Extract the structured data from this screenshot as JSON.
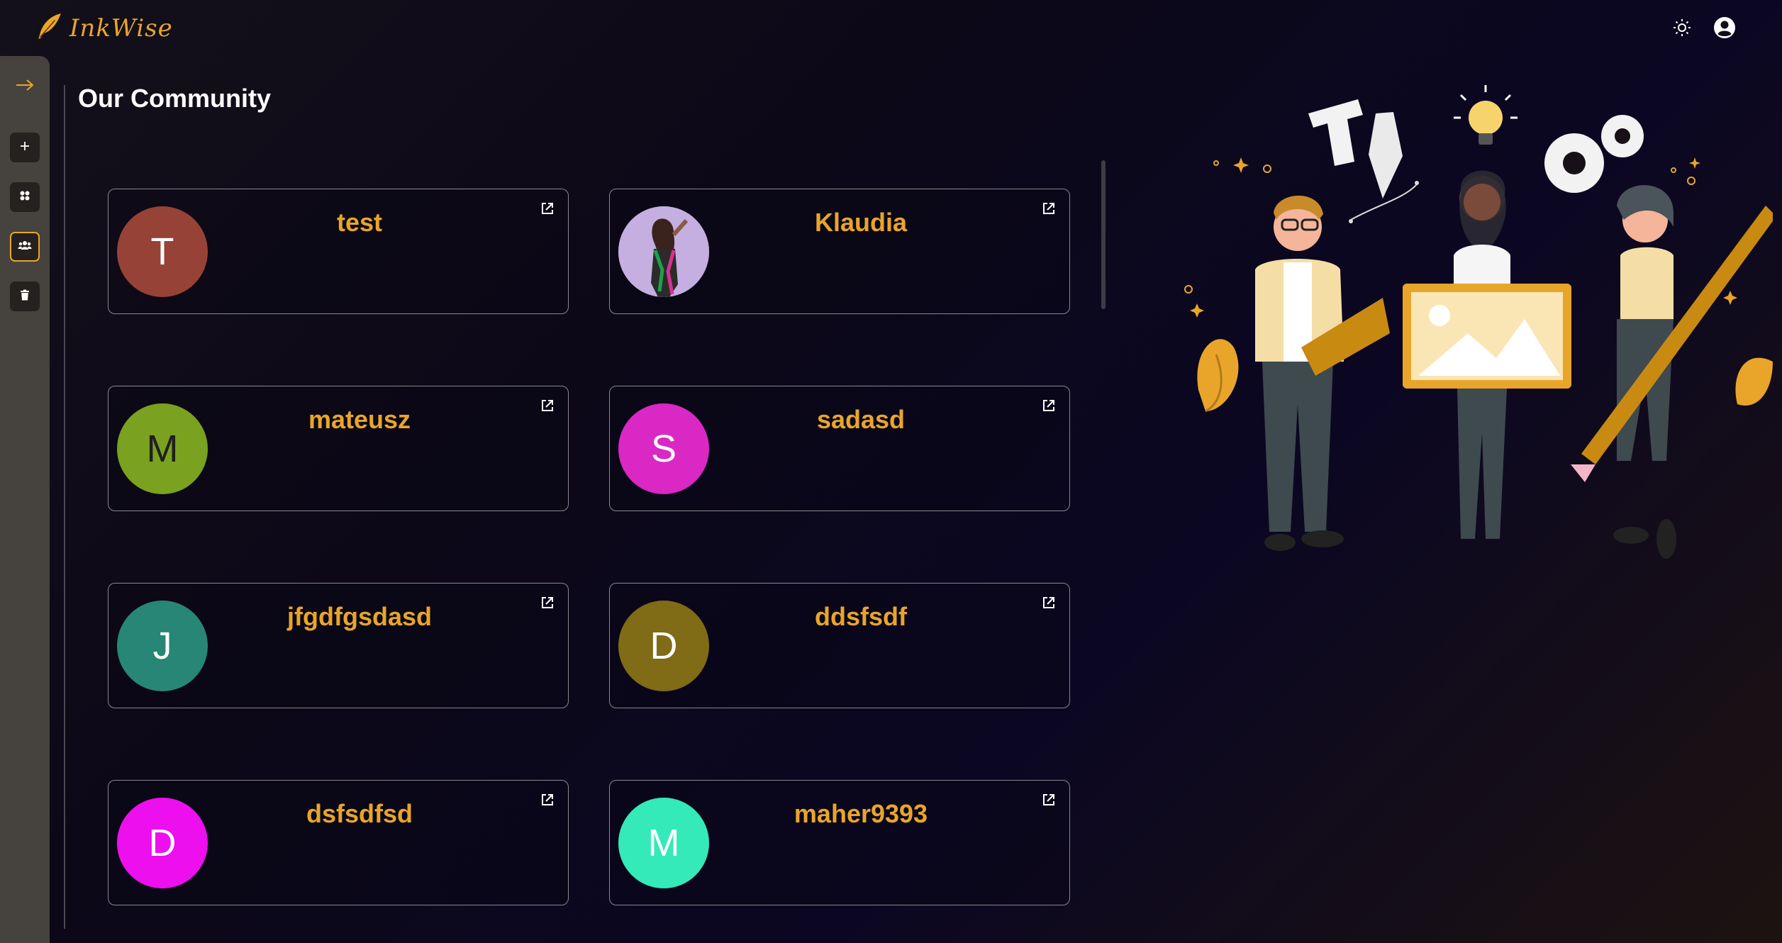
{
  "app": {
    "name": "InkWise"
  },
  "header": {
    "theme_toggle_icon": "sun-icon",
    "profile_icon": "user-circle-icon"
  },
  "sidebar": {
    "items": [
      {
        "name": "expand-arrow",
        "icon": "arrow-right-icon"
      },
      {
        "name": "add",
        "icon": "plus-icon"
      },
      {
        "name": "dashboard",
        "icon": "grid-icon"
      },
      {
        "name": "community",
        "icon": "users-icon",
        "active": true
      },
      {
        "name": "trash",
        "icon": "trash-icon"
      }
    ]
  },
  "main": {
    "title": "Our Community",
    "users": [
      {
        "name": "test",
        "initial": "T",
        "color": "#974236"
      },
      {
        "name": "Klaudia",
        "initial": "",
        "photo": true,
        "color": "#b79fd6"
      },
      {
        "name": "mateusz",
        "initial": "M",
        "color": "#7aa11f"
      },
      {
        "name": "sadasd",
        "initial": "S",
        "color": "#d928c4"
      },
      {
        "name": "jfgdfgsdasd",
        "initial": "J",
        "color": "#278675"
      },
      {
        "name": "ddsfsdf",
        "initial": "D",
        "color": "#806b16"
      },
      {
        "name": "dsfsdfsd",
        "initial": "D",
        "color": "#ee0fee"
      },
      {
        "name": "maher9393",
        "initial": "M",
        "color": "#33eab8"
      }
    ]
  },
  "colors": {
    "accent": "#e9a52a",
    "sidebar": "#46433e",
    "card_border": "#8a8790"
  }
}
